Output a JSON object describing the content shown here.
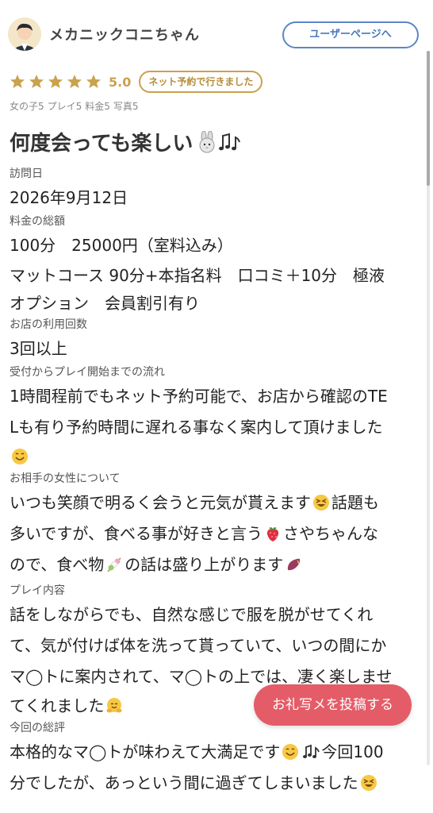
{
  "header": {
    "username": "メカニックコニちゃん",
    "user_page_button": "ユーザーページへ"
  },
  "rating": {
    "stars": 5,
    "value": "5.0",
    "badge": "ネット予約で行きました"
  },
  "sub_ratings": [
    "女の子5",
    "プレイ5",
    "料金5",
    "写真5"
  ],
  "review": {
    "title": "何度会っても楽しい",
    "visit_label": "訪問日",
    "visit_value": "2026年9月12日",
    "price_label": "料金の総額",
    "price_value_1": "100分　25000円（室料込み）",
    "price_value_2": "マットコース 90分+本指名料　口コミ＋10分　極液",
    "price_value_3": "オプション　会員割引有り",
    "count_label": "お店の利用回数",
    "count_value": "3回以上",
    "flow_label": "受付からプレイ開始までの流れ",
    "flow_value_1": "1時間程前でもネット予約可能で、お店から確認のTE",
    "flow_value_2": "Lも有り予約時間に遅れる事なく案内して頂けました",
    "girl_label": "お相手の女性について",
    "girl_value_1": "いつも笑顔で明るく会うと元気が貰えます",
    "girl_value_1b": "話題も",
    "girl_value_2": "多いですが、食べる事が好きと言う",
    "girl_value_2b": "さやちゃんな",
    "girl_value_3": "ので、食べ物",
    "girl_value_3b": "の話は盛り上がります",
    "play_label": "プレイ内容",
    "play_value_1": "話をしながらでも、自然な感じで服を脱がせてくれ",
    "play_value_2": "て、気が付けば体を洗って貰っていて、いつの間にか",
    "play_value_3": "マ◯トに案内されて、マ◯トの上では、凄く楽しませ",
    "play_value_4": "てくれました",
    "summary_label": "今回の総評",
    "summary_value_1": "本格的なマ◯トが味わえて大満足です",
    "summary_value_1b": "今回100",
    "summary_value_2": "分でしたが、あっという間に過ぎてしまいました"
  },
  "post_button": "お礼写メを投稿する",
  "colors": {
    "gold": "#c9a24d",
    "blue": "#5b86c8",
    "red": "#e45c67"
  }
}
